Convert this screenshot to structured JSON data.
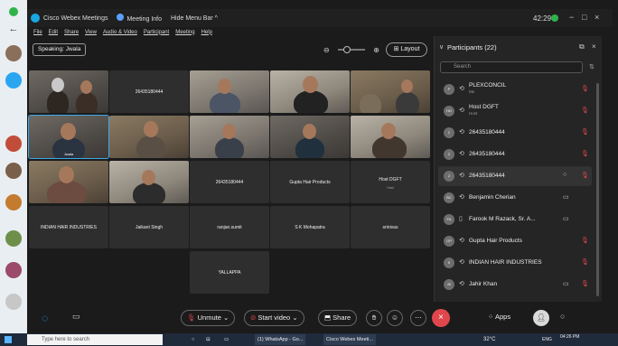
{
  "window": {
    "app_title": "Cisco Webex Meetings",
    "meeting_info": "Meeting Info",
    "hide_menu_bar": "Hide Menu Bar",
    "clock": "42:29"
  },
  "menu": [
    "File",
    "Edit",
    "Share",
    "View",
    "Audio & Video",
    "Participant",
    "Meeting",
    "Help"
  ],
  "stage": {
    "speaking_label": "Speaking: Jwala",
    "layout_label": "Layout"
  },
  "tiles": {
    "r1c2": "26435180444",
    "r2c1_label": "Jwala",
    "r3c3": "26435180444",
    "r3c4": "Gupta Hair Products",
    "r3c5": "Host DGFT",
    "r3c5_sub": "Host",
    "r4c1": "INDIAN HAIR INDUSTRIES",
    "r4c2": "Jaikant Singh",
    "r4c3": "ranjan.sumit",
    "r4c4": "S K Mohapatra",
    "r4c5": "srinivas",
    "r5c3": "YALLAPPA"
  },
  "participants_panel": {
    "title": "Participants (22)",
    "search_placeholder": "Search",
    "rows": [
      {
        "initials": "P",
        "name": "PLEXCONCIL",
        "sub": "Me"
      },
      {
        "initials": "HD",
        "name": "Host DGFT",
        "sub": "Host"
      },
      {
        "initials": "2",
        "name": "26435180444",
        "sub": ""
      },
      {
        "initials": "2",
        "name": "26435180444",
        "sub": ""
      },
      {
        "initials": "2",
        "name": "26435180444",
        "sub": ""
      },
      {
        "initials": "BC",
        "name": "Benjamin Cherian",
        "sub": ""
      },
      {
        "initials": "FA",
        "name": "Farook M Razack, Sr. A...",
        "sub": ""
      },
      {
        "initials": "GP",
        "name": "Gupta Hair Products",
        "sub": ""
      },
      {
        "initials": "II",
        "name": "INDIAN HAIR INDUSTRIES",
        "sub": ""
      },
      {
        "initials": "JK",
        "name": "Jahir Khan",
        "sub": ""
      }
    ]
  },
  "controls": {
    "unmute": "Unmute",
    "start_video": "Start video",
    "share": "Share",
    "apps": "Apps"
  },
  "taskbar": {
    "search_placeholder": "Type here to search",
    "app_whatsapp": "(1) WhatsApp - Go...",
    "app_webex": "Cisco Webex Meeti...",
    "weather": "32°C",
    "lang": "ENG",
    "time": "04:26 PM"
  }
}
